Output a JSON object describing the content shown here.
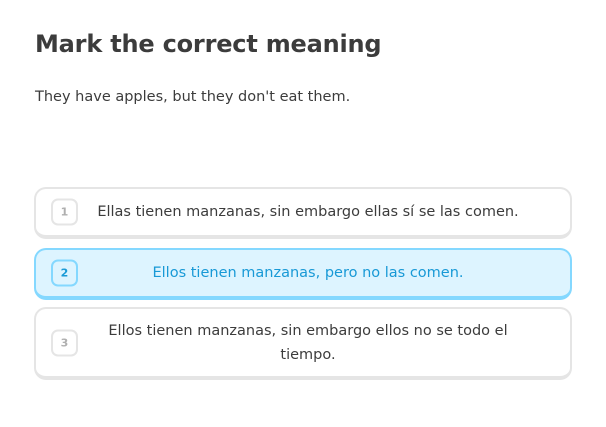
{
  "exercise": {
    "title": "Mark the correct meaning",
    "prompt": "They have apples, but they don't eat them."
  },
  "choices": [
    {
      "key": "1",
      "text": "Ellas tienen manzanas, sin embargo ellas sí se las comen.",
      "selected": false
    },
    {
      "key": "2",
      "text": "Ellos tienen manzanas, pero no las comen.",
      "selected": true
    },
    {
      "key": "3",
      "text": "Ellos tienen manzanas, sin embargo ellos no se todo el tiempo.",
      "selected": false
    }
  ],
  "colors": {
    "text": "#3c3c3c",
    "border": "#e5e5e5",
    "selected_background": "#ddf4ff",
    "selected_border": "#84d8ff",
    "selected_text": "#1899d6",
    "key_text": "#afafaf"
  }
}
